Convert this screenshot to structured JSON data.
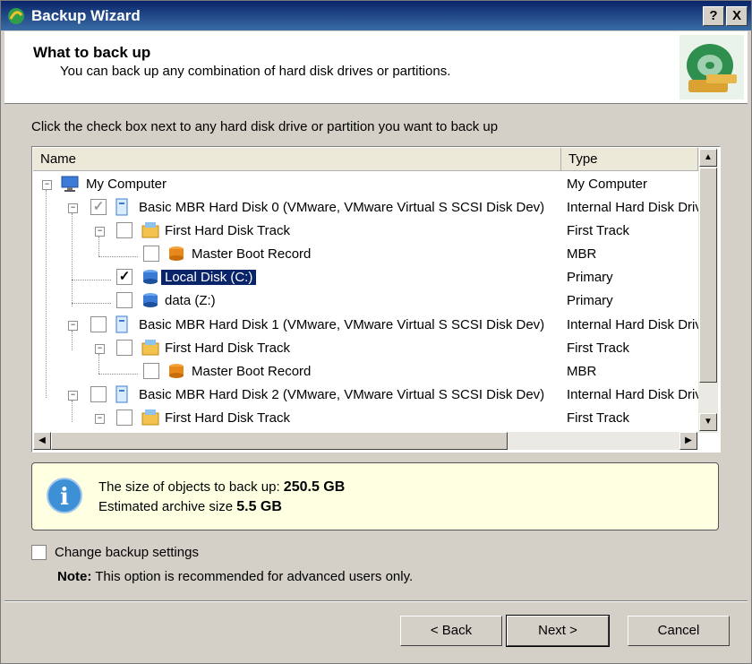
{
  "window": {
    "title": "Backup Wizard",
    "help_label": "?",
    "close_label": "X"
  },
  "header": {
    "title": "What to back up",
    "subtitle": "You can back up any combination of hard disk drives or partitions."
  },
  "instruction": "Click the check box next to any hard disk drive or partition you want to back up",
  "tree": {
    "columns": [
      "Name",
      "Type"
    ],
    "rows": [
      {
        "name": "My Computer",
        "type": "My Computer",
        "checked": null
      },
      {
        "name": "Basic MBR Hard Disk 0 (VMware, VMware Virtual S SCSI Disk Dev)",
        "type": "Internal Hard Disk Drive",
        "checked": "partial"
      },
      {
        "name": "First Hard Disk Track",
        "type": "First Track",
        "checked": false
      },
      {
        "name": "Master Boot Record",
        "type": "MBR",
        "checked": false
      },
      {
        "name": "Local Disk (C:)",
        "type": "Primary",
        "checked": true,
        "selected": true
      },
      {
        "name": "data (Z:)",
        "type": "Primary",
        "checked": false
      },
      {
        "name": "Basic MBR Hard Disk 1 (VMware, VMware Virtual S SCSI Disk Dev)",
        "type": "Internal Hard Disk Drive",
        "checked": false
      },
      {
        "name": "First Hard Disk Track",
        "type": "First Track",
        "checked": false
      },
      {
        "name": "Master Boot Record",
        "type": "MBR",
        "checked": false
      },
      {
        "name": "Basic MBR Hard Disk 2 (VMware, VMware Virtual S SCSI Disk Dev)",
        "type": "Internal Hard Disk Drive",
        "checked": false
      },
      {
        "name": "First Hard Disk Track",
        "type": "First Track",
        "checked": false
      }
    ]
  },
  "info": {
    "size_label": "The size of objects to back up:",
    "size_value": "250.5 GB",
    "archive_label": "Estimated archive size",
    "archive_value": "5.5 GB"
  },
  "options": {
    "change_settings_label": "Change backup settings",
    "change_settings_checked": false,
    "note_label": "Note:",
    "note_text": "This option is recommended for advanced users only."
  },
  "buttons": {
    "back": "< Back",
    "next": "Next >",
    "cancel": "Cancel"
  },
  "colors": {
    "titlebar": "#0a246a",
    "selection": "#0a246a",
    "info_bg": "#ffffe1"
  }
}
